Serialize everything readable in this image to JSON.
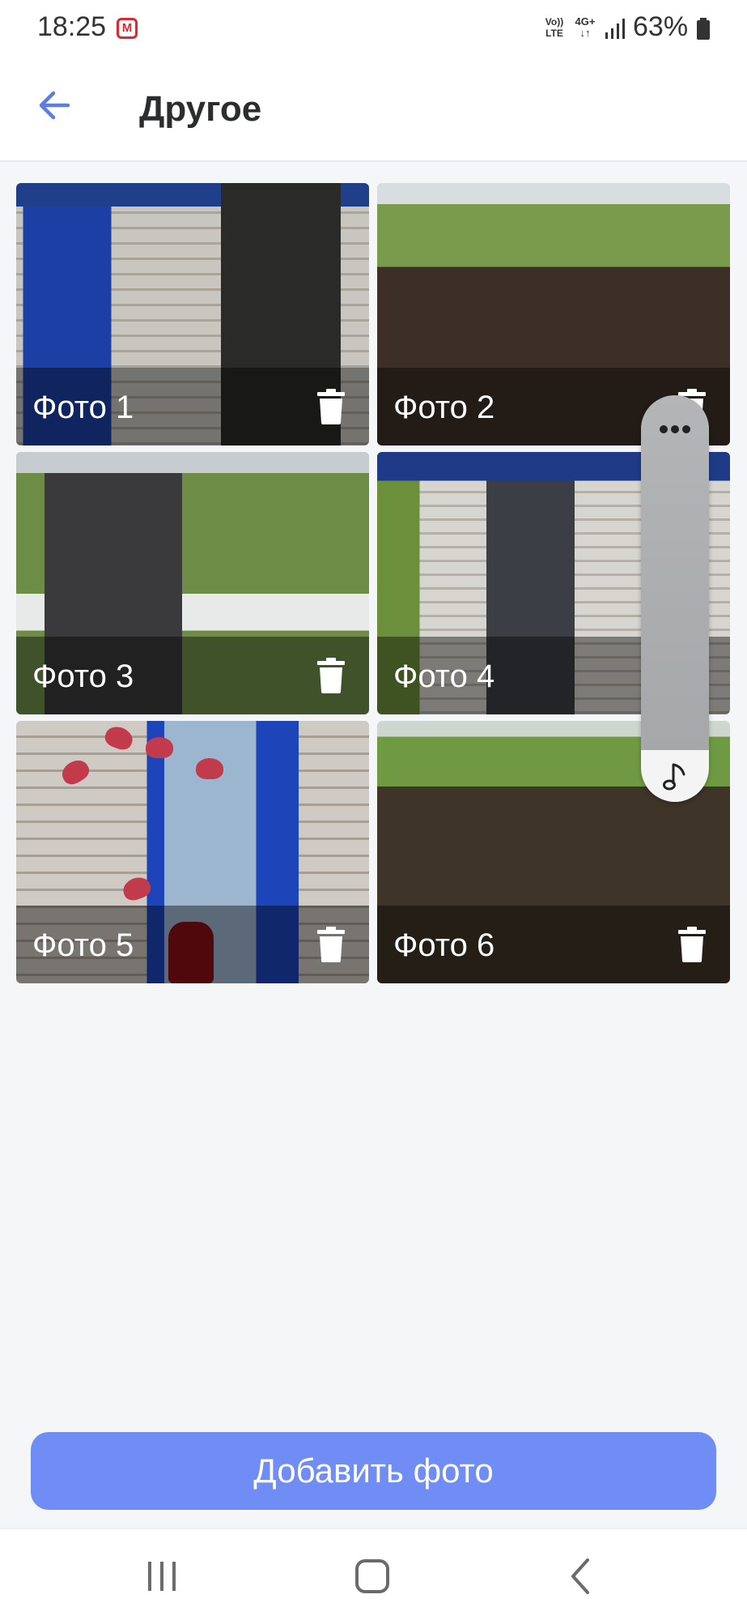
{
  "status_bar": {
    "time": "18:25",
    "carrier_badge": "M",
    "volte": "Vo)) LTE",
    "network": "4G+",
    "battery_percent": "63%"
  },
  "header": {
    "title": "Другое",
    "back_icon": "arrow-left-icon"
  },
  "photos": [
    {
      "label": "Фото 1",
      "icon": "trash-icon"
    },
    {
      "label": "Фото 2",
      "icon": "trash-icon"
    },
    {
      "label": "Фото 3",
      "icon": "trash-icon"
    },
    {
      "label": "Фото 4",
      "icon": "trash-icon"
    },
    {
      "label": "Фото 5",
      "icon": "trash-icon"
    },
    {
      "label": "Фото 6",
      "icon": "trash-icon"
    }
  ],
  "side_panel": {
    "top_icon": "more-dots-icon",
    "bottom_icon": "music-note-icon"
  },
  "add_button": {
    "label": "Добавить фото"
  },
  "nav_bar": {
    "items": [
      "recents-icon",
      "home-icon",
      "back-icon"
    ]
  },
  "colors": {
    "accent": "#6f8df4",
    "back_arrow": "#5a7fe0",
    "background": "#f5f6f8"
  }
}
